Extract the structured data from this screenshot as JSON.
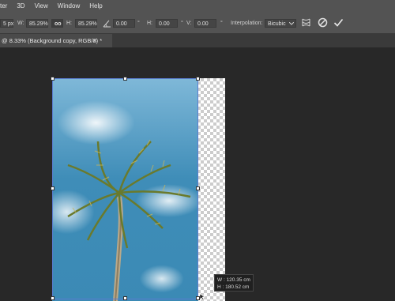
{
  "menu": {
    "items": [
      "ter",
      "3D",
      "View",
      "Window",
      "Help"
    ]
  },
  "options": {
    "x_value": "5 px",
    "w_label": "W:",
    "w_value": "85.29%",
    "link_label": "oo",
    "h_label": "H:",
    "h_value": "85.29%",
    "angle_value": "0.00",
    "angle_unit": "°",
    "hskew_label": "H:",
    "hskew_value": "0.00",
    "hskew_unit": "°",
    "vskew_label": "V:",
    "vskew_value": "0.00",
    "vskew_unit": "°",
    "interp_label": "Interpolation:",
    "interp_value": "Bicubic"
  },
  "document": {
    "tab_title": "@ 8.33% (Background copy, RGB/8) *",
    "close": "×"
  },
  "readout": {
    "w_label": "W :",
    "w_value": "120.35 cm",
    "h_label": "H :",
    "h_value": "180.52 cm"
  }
}
